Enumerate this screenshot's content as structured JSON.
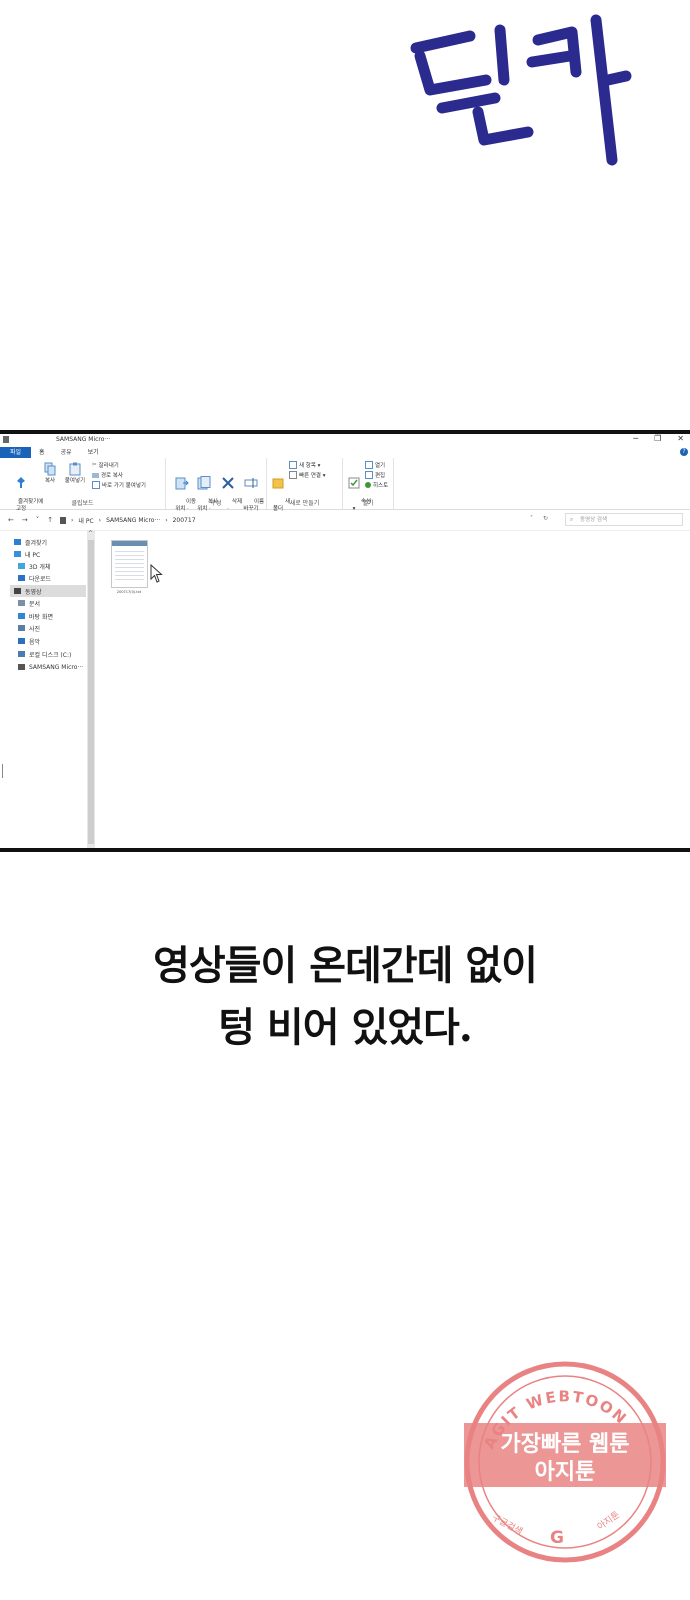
{
  "sfx": {
    "text": "딸칵",
    "color": "#2b2a8f"
  },
  "window": {
    "title": "SAMSANG Micro···",
    "controls": [
      "─",
      "❐",
      "✕"
    ],
    "menu": [
      "파일",
      "홈",
      "공유",
      "보기"
    ],
    "ribbon": {
      "clipboard": {
        "pin_label": "즐겨찾기에\n고정",
        "copy_label": "복사",
        "paste_label": "붙여넣기",
        "cut_label": "잘라내기",
        "copy_path_label": "경로 복사",
        "paste_shortcut_label": "바로 가기 붙여넣기",
        "group_label": "클립보드"
      },
      "organize": {
        "move_label": "이동\n위치 ·",
        "copyto_label": "복사\n위치 ·",
        "delete_label": "삭제\n·",
        "rename_label": "이름\n바꾸기",
        "group_label": "구성"
      },
      "new": {
        "newfolder_label": "새\n폴더",
        "newitem_label": "새 항목 ▾",
        "easyaccess_label": "빠른 연결 ▾",
        "group_label": "새로 만들기"
      },
      "open": {
        "properties_label": "속성\n▾",
        "open_label": "열기",
        "edit_label": "편집",
        "history_label": "히스토",
        "group_label": "열기"
      }
    },
    "address": {
      "nav": [
        "←",
        "→",
        "˅",
        "↑"
      ],
      "crumbs": [
        "내 PC",
        "SAMSANG Micro···",
        "200717"
      ],
      "separator": "›",
      "refresh": "↻",
      "dropdown": "˅",
      "search_placeholder": "동영상 검색"
    },
    "navpane": [
      {
        "label": "즐겨찾기",
        "icon": "star-icon",
        "color": "#2d7fd3"
      },
      {
        "label": "내 PC",
        "icon": "pc-icon",
        "color": "#3a8fd8"
      },
      {
        "label": "3D 개체",
        "icon": "cube-icon",
        "color": "#3fa6e0"
      },
      {
        "label": "다운로드",
        "icon": "download-icon",
        "color": "#2a73c4"
      },
      {
        "label": "동영상",
        "icon": "video-icon",
        "color": "#444444"
      },
      {
        "label": "문서",
        "icon": "document-icon",
        "color": "#7b8fa8"
      },
      {
        "label": "바탕 화면",
        "icon": "desktop-icon",
        "color": "#2f86d6"
      },
      {
        "label": "사진",
        "icon": "picture-icon",
        "color": "#5a7fa0"
      },
      {
        "label": "음악",
        "icon": "music-icon",
        "color": "#2b6fc0"
      },
      {
        "label": "로컬 디스크 (C:)",
        "icon": "disk-icon",
        "color": "#4a7db0"
      },
      {
        "label": "SAMSANG Micro···",
        "icon": "usb-icon",
        "color": "#555555"
      }
    ],
    "file": {
      "name": "200717(0).txt"
    }
  },
  "narration": [
    "영상들이 온데간데 없이",
    "텅 비어 있었다."
  ],
  "watermark": {
    "arc_text": "AGIT WEBTOON",
    "line1": "가장빠른 웹툰",
    "line2": "아지툰",
    "bottom_left": "구글검색",
    "bottom_mark": "G",
    "bottom_right": "아지툰",
    "color": "#e25a5a"
  }
}
